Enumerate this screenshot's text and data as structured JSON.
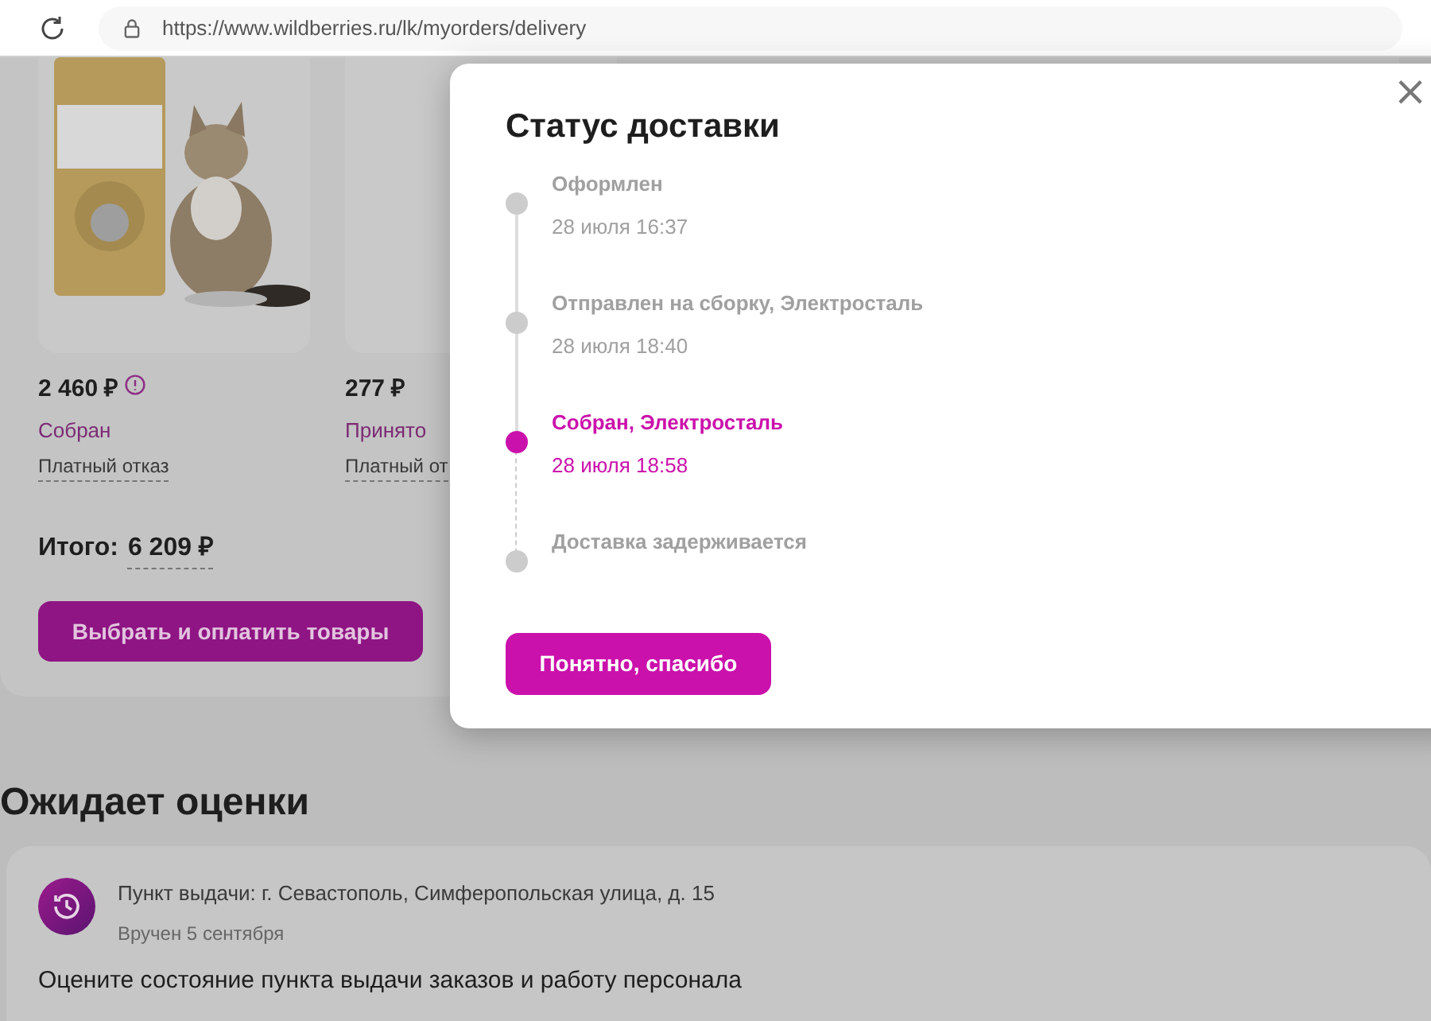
{
  "browser": {
    "url": "https://www.wildberries.ru/lk/myorders/delivery"
  },
  "order": {
    "items": [
      {
        "price": "2 460 ₽",
        "warning": true,
        "status": "Собран",
        "refusal": "Платный отказ"
      },
      {
        "price": "277 ₽",
        "warning": false,
        "status": "Принято",
        "refusal": "Платный от"
      }
    ],
    "total_label": "Итого:",
    "total_value": "6 209 ₽",
    "pay_button": "Выбрать и оплатить товары"
  },
  "review_section": {
    "title": "Ожидает оценки",
    "pickup_point": "Пункт выдачи: г. Севастополь, Симферопольская улица, д. 15",
    "delivered": "Вручен 5 сентября",
    "prompt": "Оцените состояние пункта выдачи заказов и работу персонала"
  },
  "modal": {
    "title": "Статус доставки",
    "close": "×",
    "steps": [
      {
        "label": "Оформлен",
        "time": "28 июля 16:37",
        "selected": false
      },
      {
        "label": "Отправлен на сборку, Электросталь",
        "time": "28 июля 18:40",
        "selected": false
      },
      {
        "label": "Собран, Электросталь",
        "time": "28 июля 18:58",
        "selected": true
      },
      {
        "label": "Доставка задерживается",
        "selected": false
      }
    ],
    "button": "Понятно, спасибо"
  }
}
